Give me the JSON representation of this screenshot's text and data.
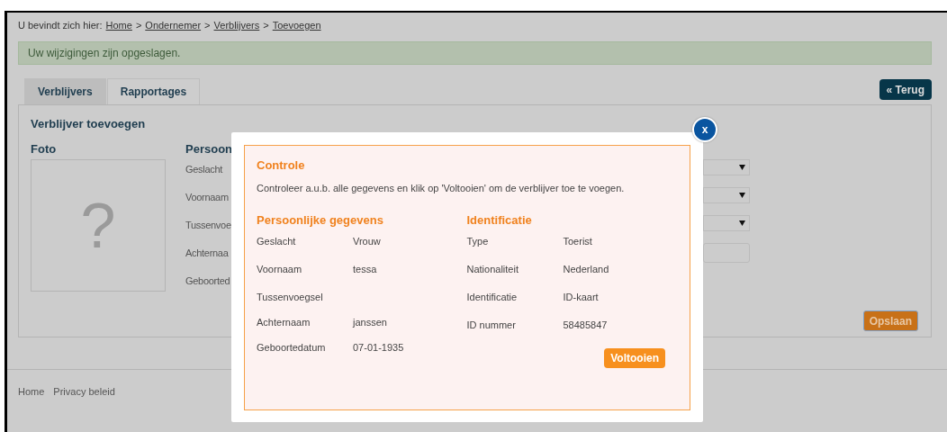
{
  "breadcrumb": [
    {
      "kind": "label",
      "text": "U bevindt zich hier:"
    },
    {
      "kind": "link",
      "text": "Home"
    },
    {
      "kind": "separator",
      "text": ">"
    },
    {
      "kind": "link",
      "text": "Ondernemer"
    },
    {
      "kind": "separator",
      "text": ">"
    },
    {
      "kind": "link",
      "text": "Verblijvers"
    },
    {
      "kind": "separator",
      "text": ">"
    },
    {
      "kind": "link",
      "text": "Toevoegen"
    }
  ],
  "message": "Uw wijzigingen zijn opgeslagen.",
  "tabs": [
    {
      "label": "Verblijvers",
      "selected": true
    },
    {
      "label": "Rapportages",
      "selected": false
    }
  ],
  "back_button": "« Terug",
  "panel": {
    "title": "Verblijver toevoegen",
    "photo": {
      "label": "Foto",
      "mark": "?"
    },
    "form": {
      "heading": "Persoon",
      "labels": [
        "Geslacht",
        "Voornaam",
        "Tussenvoe",
        "Achternaa",
        "Geboorted"
      ],
      "fields": [
        {
          "kind": "select"
        },
        {
          "kind": "select"
        },
        {
          "kind": "select"
        },
        {
          "kind": "text"
        }
      ]
    },
    "save_button": "Opslaan"
  },
  "footer": [
    "Home",
    "Privacy beleid"
  ],
  "modal": {
    "close": "x",
    "title": "Controle",
    "description": "Controleer a.u.b. alle gegevens en klik op 'Voltooien' om de verblijver toe te voegen.",
    "sections": [
      {
        "heading": "Persoonlijke gegevens",
        "rows": [
          {
            "label": "Geslacht",
            "value": "Vrouw"
          },
          {
            "label": "Voornaam",
            "value": "tessa"
          },
          {
            "label": "Tussenvoegsel"
          },
          {
            "label": "Achternaam",
            "value": "janssen"
          },
          {
            "label": "Geboortedatum",
            "value": "07-01-1935"
          }
        ]
      },
      {
        "heading": "Identificatie",
        "rows": [
          {
            "label": "Type",
            "value": "Toerist"
          },
          {
            "label": "Nationaliteit",
            "value": "Nederland"
          },
          {
            "label": "Identificatie",
            "value": "ID-kaart"
          },
          {
            "label": "ID nummer",
            "value": "58485847"
          }
        ]
      }
    ],
    "button": "Voltooien"
  }
}
